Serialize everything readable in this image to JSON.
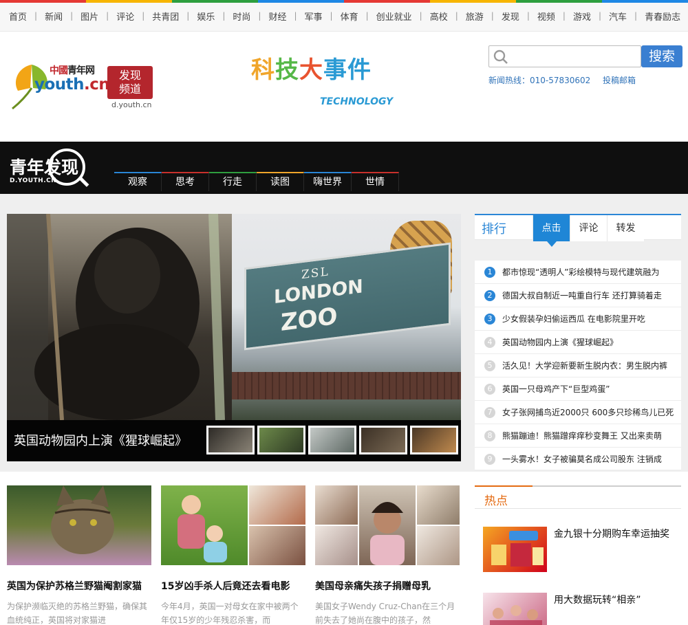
{
  "colors": {
    "rainbow": [
      "#e53935",
      "#f7b500",
      "#2e9f3f",
      "#1e88e5",
      "#e53935",
      "#f7b500",
      "#2e9f3f",
      "#1e88e5"
    ],
    "brand_blue": "#2a86d6",
    "hot_orange": "#e46a11",
    "tab_accents": [
      "#2a86d6",
      "#c9302c",
      "#2e9f3f",
      "#f0a52b",
      "#2a86d6",
      "#c9302c"
    ]
  },
  "topnav": [
    "首页",
    "新闻",
    "图片",
    "评论",
    "共青团",
    "娱乐",
    "时尚",
    "财经",
    "军事",
    "体育",
    "创业就业",
    "高校",
    "旅游",
    "发现",
    "视频",
    "游戏",
    "汽车",
    "青春励志"
  ],
  "header": {
    "logo_cn_red": "中國",
    "logo_cn_dark": "青年网",
    "logo_youth": "youth",
    "logo_domain_ext": ".cn",
    "logo_stamp_1": "发现",
    "logo_stamp_2": "频道",
    "logo_url": "d.youth.cn",
    "tech_chars": [
      "科",
      "技",
      "大",
      "事件"
    ],
    "tech_en": "TECHNOLOGY",
    "search_button": "搜索",
    "search_value": "",
    "hotline": "新闻热线：010-57830602",
    "email_link": "投稿邮箱"
  },
  "channel": {
    "logo_text": "青年发现",
    "logo_url": "D.YOUTH.CN",
    "tabs": [
      "观察",
      "思考",
      "行走",
      "读图",
      "嗨世界",
      "世情"
    ]
  },
  "slider": {
    "caption": "英国动物园内上演《猩球崛起》",
    "sign_zsl": "ZSL",
    "sign_london": "LONDON",
    "sign_zoo": "ZOO"
  },
  "ranking": {
    "title": "排行",
    "tabs": [
      "点击",
      "评论",
      "转发"
    ],
    "active_tab": "点击",
    "items": [
      "都市惊现“透明人”彩绘模特与现代建筑融为",
      "德国大叔自制近一吨重自行车 还打算骑着走",
      "少女假装孕妇偷运西瓜 在电影院里开吃",
      "英国动物园内上演《猩球崛起》",
      "活久见！大学迎新要新生脱内衣：男生脱内裤",
      "英国一只母鸡产下“巨型鸡蛋”",
      "女子张网捕鸟近2000只 600多只珍稀鸟儿已死",
      "熊猫蹦迪！熊猫蹭痒痒秒变舞王 又出来卖萌",
      "一头雾水！女子被骗莫名成公司股东 注销成"
    ]
  },
  "cards": [
    {
      "title": "英国为保护苏格兰野猫阉割家猫",
      "summary": "为保护濒临灭绝的苏格兰野猫，确保其血统纯正，英国将对家猫进"
    },
    {
      "title": "15岁凶手杀人后竟还去看电影",
      "summary": "今年4月，英国一对母女在家中被两个年仅15岁的少年残忍杀害，而"
    },
    {
      "title": "美国母亲痛失孩子捐赠母乳",
      "summary": "美国女子Wendy Cruz-Chan在三个月前失去了她尚在腹中的孩子，然"
    }
  ],
  "hot": {
    "title": "热点",
    "items": [
      "金九银十分期购车幸运抽奖",
      "用大数据玩转“相亲”"
    ]
  }
}
